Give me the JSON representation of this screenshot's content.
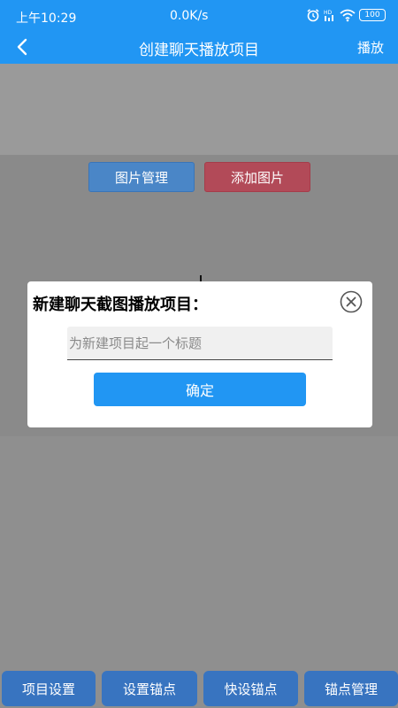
{
  "status_bar": {
    "time": "上午10:29",
    "speed": "0.0K/s",
    "battery": "100",
    "icons": [
      "alarm-icon",
      "hd-icon",
      "wifi-icon",
      "battery-icon"
    ]
  },
  "header": {
    "title": "创建聊天播放项目",
    "back_icon": "back-arrow-icon",
    "play_label": "播放"
  },
  "main": {
    "image_manage_label": "图片管理",
    "add_image_label": "添加图片"
  },
  "bottom_nav": {
    "items": [
      {
        "label": "项目设置"
      },
      {
        "label": "设置锚点"
      },
      {
        "label": "快设锚点"
      },
      {
        "label": "锚点管理"
      }
    ]
  },
  "dialog": {
    "title": "新建聊天截图播放项目：",
    "close_icon": "close-circle-icon",
    "input_value": "",
    "input_placeholder": "为新建项目起一个标题",
    "confirm_label": "确定"
  },
  "colors": {
    "primary": "#2196f3",
    "image_manage_button": "#4a86c7",
    "add_image_button": "#b24a58",
    "nav_button": "#3874c0"
  }
}
